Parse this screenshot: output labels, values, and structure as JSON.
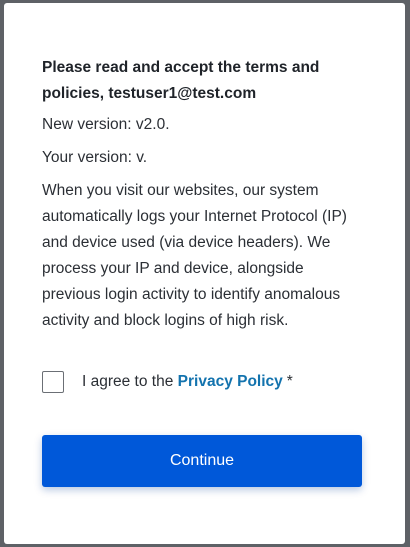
{
  "terms": {
    "heading": "Please read and accept the terms and policies, testuser1@test.com",
    "new_version": "New version: v2.0.",
    "your_version": "Your version: v.",
    "description": "When you visit our websites, our system automatically logs your Internet Protocol (IP) and device used (via device headers). We process your IP and device, alongside previous login activity to identify anomalous activity and block logins of high risk."
  },
  "agreement": {
    "checked": false,
    "label_prefix": "I agree to the",
    "link_text": "Privacy Policy",
    "required_marker": "*"
  },
  "actions": {
    "continue_label": "Continue"
  },
  "colors": {
    "primary_button": "#0058d9",
    "link": "#1373ae",
    "text": "#2b2f35"
  }
}
